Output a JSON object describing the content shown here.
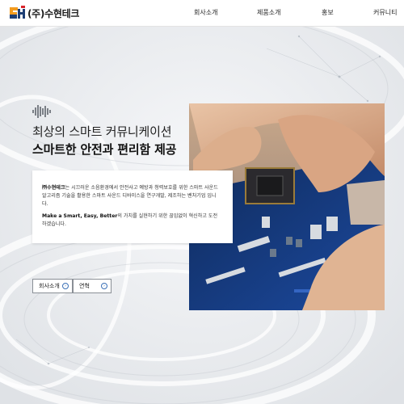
{
  "header": {
    "logo_text": "(주)수현테크",
    "nav": [
      "회사소개",
      "제품소개",
      "홍보",
      "커뮤니티"
    ]
  },
  "hero": {
    "headline_line1": "최상의 스마트 커뮤니케이션",
    "headline_line2": "스마트한 안전과 편리함 제공",
    "card": {
      "p1_company": "㈜수현테크",
      "p1_rest": "는 시끄러운 소음환경에서 안전사고 예방과 청력보호를 위한 스마트 사운드 알고리즘 기술을 활용한 스마트 사운드 디바이스을 연구개발, 제조하는 벤처기업 입니다.",
      "p2_bold": "Make a Smart, Easy, Better",
      "p2_rest": "의 가치를 실현하기 위한 끊임없이 혁신하고 도전하겠습니다."
    },
    "buttons": [
      {
        "label": "회사소개"
      },
      {
        "label": "연혁"
      }
    ]
  },
  "icons": {
    "logo": "suhyun-logo-icon",
    "sound_wave": "sound-wave-icon",
    "button_arrow": "circle-arrow-icon"
  },
  "colors": {
    "accent_blue": "#3a6fb6",
    "logo_orange": "#f39b1e",
    "background": "#f1f2f4"
  }
}
